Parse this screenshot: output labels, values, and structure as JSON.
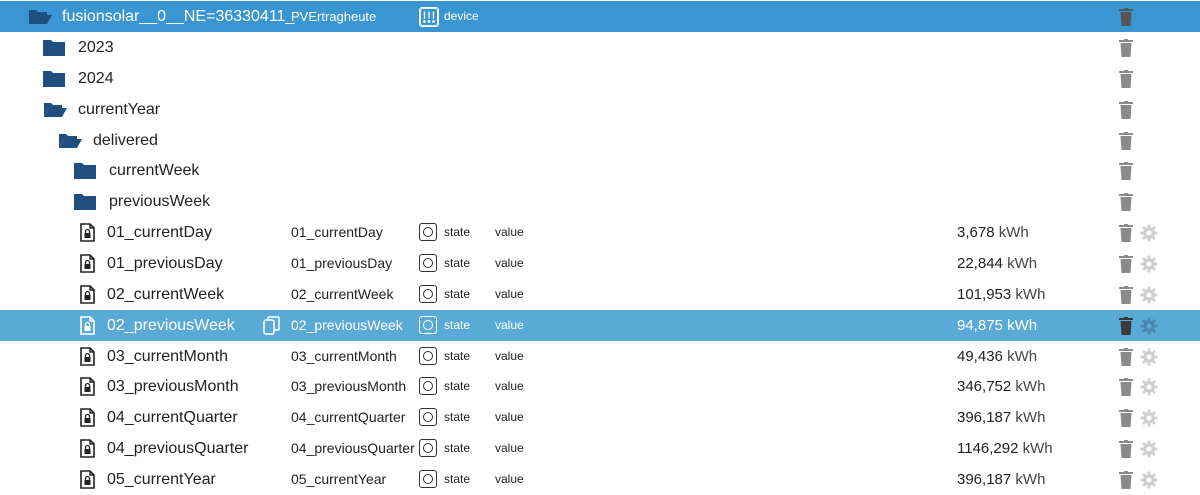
{
  "root": {
    "name": "fusionsolar__0__NE=36330411_",
    "subname": "PVErtragheute",
    "role": "device",
    "role_icon": "device-icon"
  },
  "folders": [
    {
      "name": "2023",
      "state": "closed"
    },
    {
      "name": "2024",
      "state": "closed"
    },
    {
      "name": "currentYear",
      "state": "open"
    },
    {
      "name": "delivered",
      "state": "open"
    },
    {
      "name": "currentWeek",
      "state": "closed"
    },
    {
      "name": "previousWeek",
      "state": "closed"
    }
  ],
  "states": [
    {
      "name": "01_currentDay",
      "subname": "01_currentDay",
      "type": "state",
      "role": "value",
      "value": "3,678",
      "unit": "kWh"
    },
    {
      "name": "01_previousDay",
      "subname": "01_previousDay",
      "type": "state",
      "role": "value",
      "value": "22,844",
      "unit": "kWh"
    },
    {
      "name": "02_currentWeek",
      "subname": "02_currentWeek",
      "type": "state",
      "role": "value",
      "value": "101,953",
      "unit": "kWh"
    },
    {
      "name": "02_previousWeek",
      "subname": "02_previousWeek",
      "type": "state",
      "role": "value",
      "value": "94,875",
      "unit": "kWh",
      "selected": true
    },
    {
      "name": "03_currentMonth",
      "subname": "03_currentMonth",
      "type": "state",
      "role": "value",
      "value": "49,436",
      "unit": "kWh"
    },
    {
      "name": "03_previousMonth",
      "subname": "03_previousMonth",
      "type": "state",
      "role": "value",
      "value": "346,752",
      "unit": "kWh"
    },
    {
      "name": "04_currentQuarter",
      "subname": "04_currentQuarter",
      "type": "state",
      "role": "value",
      "value": "396,187",
      "unit": "kWh"
    },
    {
      "name": "04_previousQuarter",
      "subname": "04_previousQuarter",
      "type": "state",
      "role": "value",
      "value": "1146,292",
      "unit": "kWh"
    },
    {
      "name": "05_currentYear",
      "subname": "05_currentYear",
      "type": "state",
      "role": "value",
      "value": "396,187",
      "unit": "kWh"
    }
  ],
  "colors": {
    "root_bg": "#3a96d0",
    "selected_bg": "#5aaad6",
    "folder": "#1f4e7f",
    "trash": "#8a8a8a",
    "gear": "#cfcfcf"
  }
}
